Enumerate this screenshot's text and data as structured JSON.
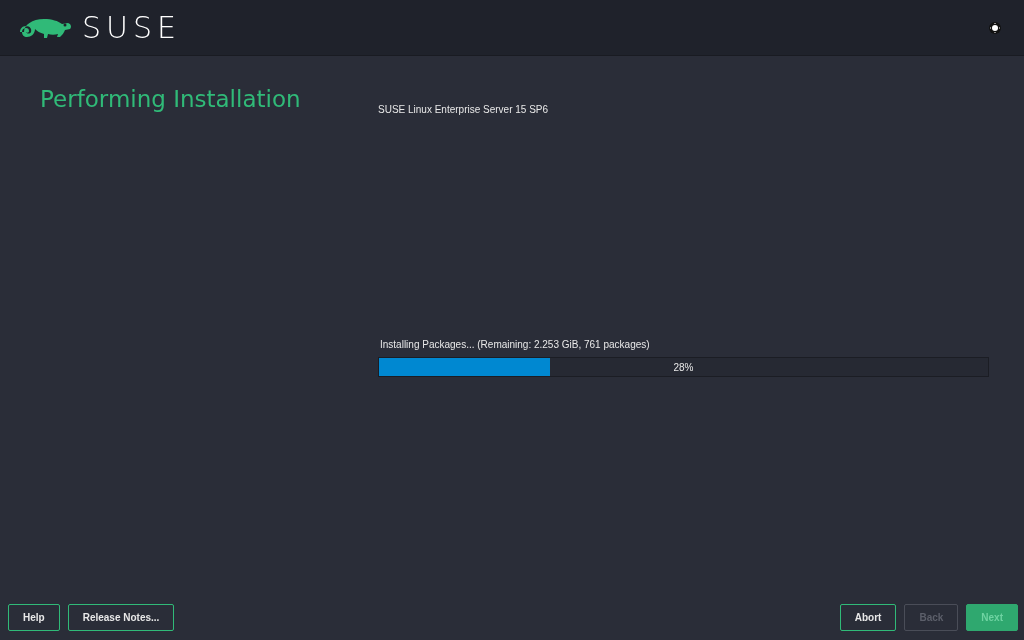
{
  "header": {
    "logo_text": "SUSE",
    "theme_toggle": {
      "on": false
    }
  },
  "title": "Performing Installation",
  "product": "SUSE Linux Enterprise Server 15 SP6",
  "progress": {
    "label": "Installing Packages... (Remaining: 2.253 GiB, 761 packages)",
    "level": 0.28,
    "reading": "28%"
  },
  "buttons_left": [
    {
      "label": "Help",
      "kind": "secondary",
      "disabled": false
    },
    {
      "label": "Release Notes...",
      "kind": "secondary",
      "disabled": false
    }
  ],
  "buttons_right": [
    {
      "label": "Abort",
      "kind": "secondary",
      "disabled": false
    },
    {
      "label": "Back",
      "kind": "secondary",
      "disabled": true
    },
    {
      "label": "Next",
      "kind": "primary",
      "disabled": true
    }
  ]
}
